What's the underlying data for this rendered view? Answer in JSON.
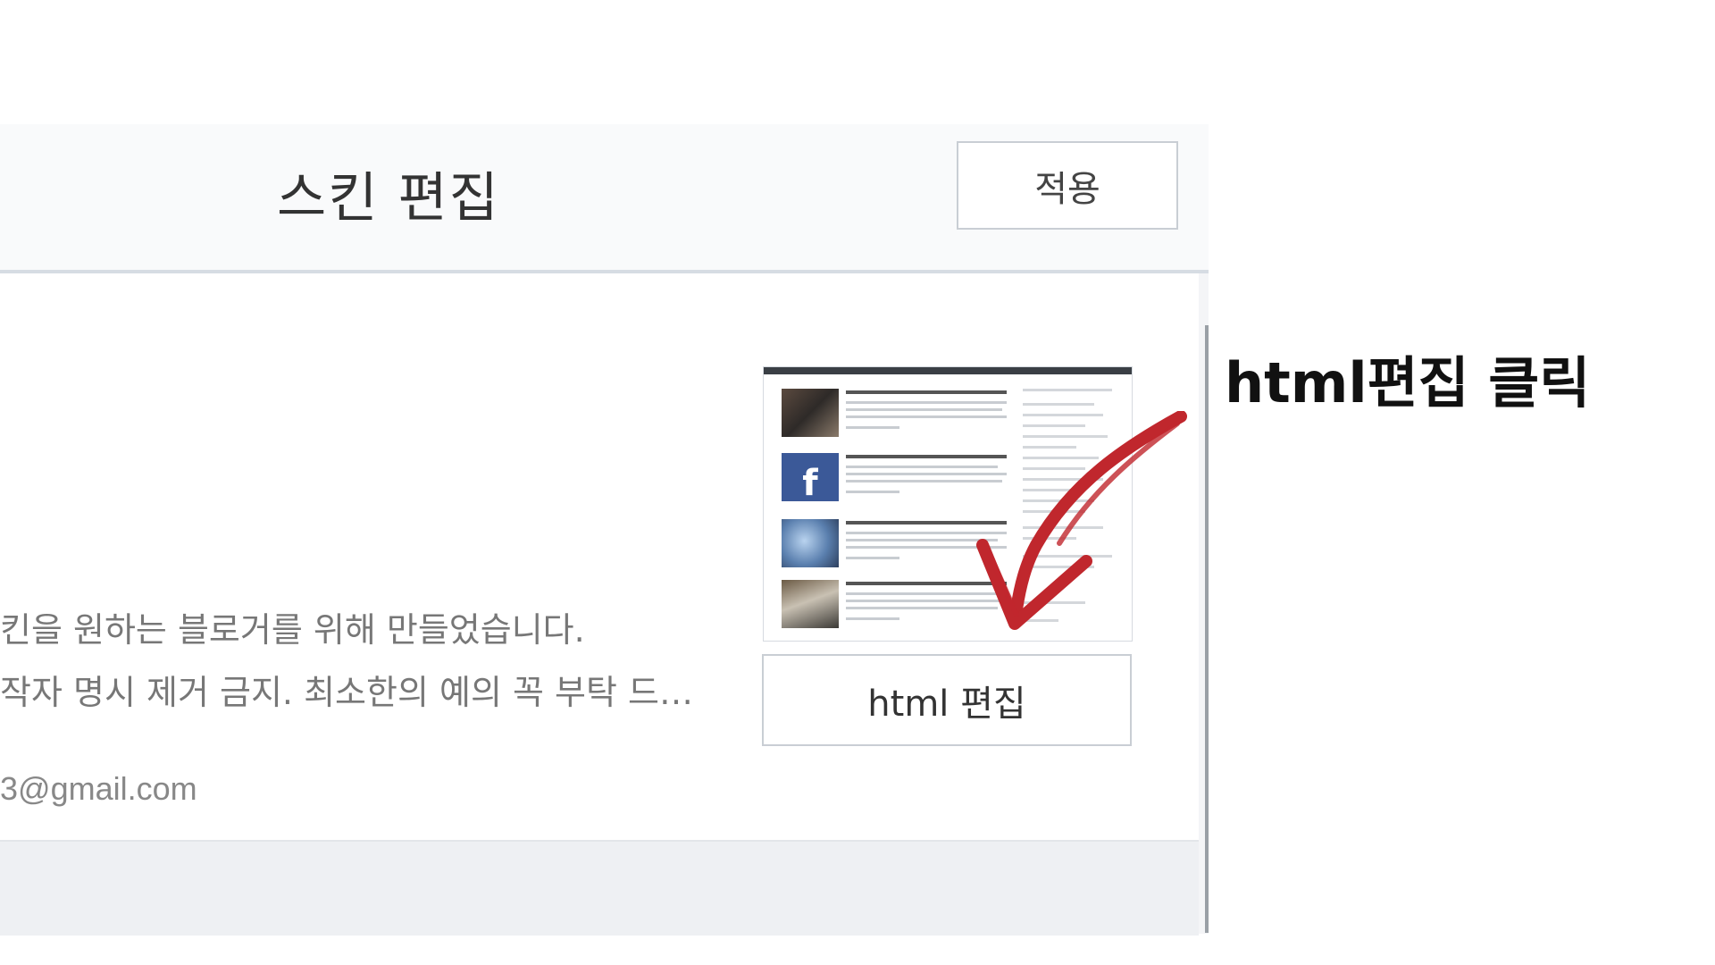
{
  "header": {
    "title": "스킨 편집",
    "apply_label": "적용"
  },
  "skin": {
    "description_line1": "킨을 원하는 블로거를 위해 만들었습니다.",
    "description_line2": "작자 명시 제거 금지. 최소한의 예의 꼭 부탁 드…",
    "email": "3@gmail.com"
  },
  "preview": {
    "facebook_letter": "f",
    "html_edit_label": "html 편집"
  },
  "annotation": {
    "text": "html편집 클릭",
    "arrow_color": "#c0272d"
  },
  "colors": {
    "header_bg": "#f9fafb",
    "facebook": "#3b5998"
  }
}
